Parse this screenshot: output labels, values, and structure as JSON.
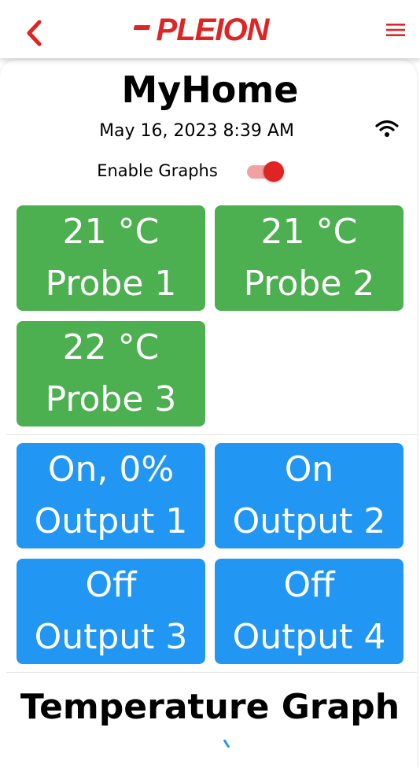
{
  "header": {
    "logo_text": "PLEION",
    "back_icon": "chevron-left-icon",
    "menu_icon": "hamburger-menu-icon",
    "accent_color": "#e02424"
  },
  "device": {
    "title": "MyHome",
    "datetime": "May 16, 2023 8:39 AM",
    "wifi_icon": "wifi-icon"
  },
  "graphs": {
    "label": "Enable Graphs",
    "enabled": true
  },
  "probes": [
    {
      "value": "21 °C",
      "label": "Probe 1"
    },
    {
      "value": "21 °C",
      "label": "Probe 2"
    },
    {
      "value": "22 °C",
      "label": "Probe 3"
    }
  ],
  "outputs": [
    {
      "value": "On, 0%",
      "label": "Output 1"
    },
    {
      "value": "On",
      "label": "Output 2"
    },
    {
      "value": "Off",
      "label": "Output 3"
    },
    {
      "value": "Off",
      "label": "Output 4"
    }
  ],
  "temperature_graph": {
    "title": "Temperature Graph"
  },
  "colors": {
    "probe_tile": "#4caf50",
    "output_tile": "#2196f3",
    "toggle_on": "#e02424"
  }
}
